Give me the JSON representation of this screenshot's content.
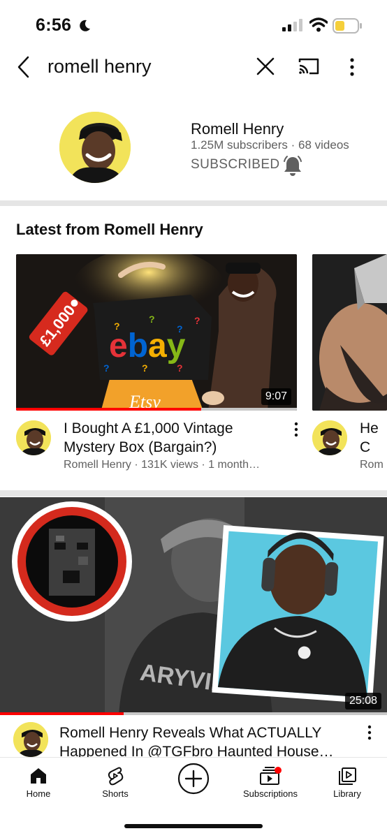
{
  "status_bar": {
    "time": "6:56"
  },
  "search": {
    "query": "romell henry"
  },
  "channel": {
    "name": "Romell Henry",
    "meta": "1.25M subscribers · 68 videos",
    "subscribed_label": "SUBSCRIBED"
  },
  "section": {
    "title": "Latest from Romell Henry"
  },
  "videos": [
    {
      "title": "I Bought A £1,000 Vintage Mystery Box (Bargain?)",
      "meta": "Romell Henry · 131K views · 1 month…",
      "duration": "9:07",
      "progress": 0.66,
      "thumb_texts": {
        "tag": "£1,000",
        "brand": "ebay",
        "shop": "Etsy"
      }
    },
    {
      "title": "He C CHA",
      "meta": "Rom",
      "progress": 0
    }
  ],
  "featured": {
    "title": "Romell Henry Reveals What ACTUALLY Happened In @TGFbro Haunted House…",
    "duration": "25:08",
    "progress": 0.32,
    "thumb_texts": {
      "shirt": "ARYVILL"
    }
  },
  "bottom_nav": [
    {
      "label": "Home",
      "icon": "home-icon"
    },
    {
      "label": "Shorts",
      "icon": "shorts-icon"
    },
    {
      "label": "",
      "icon": "create-icon"
    },
    {
      "label": "Subscriptions",
      "icon": "subscriptions-icon"
    },
    {
      "label": "Library",
      "icon": "library-icon"
    }
  ],
  "colors": {
    "brand_red": "#ff0000",
    "avatar_yellow": "#f2e35a",
    "secondary_text": "#606060"
  }
}
